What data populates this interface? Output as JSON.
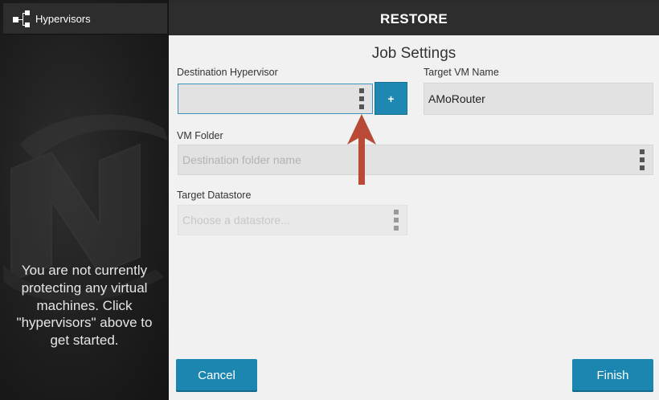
{
  "sidebar": {
    "header_label": "Hypervisors",
    "empty_message": "You are not currently protecting any virtual machines. Click \"hypervisors\" above to get started."
  },
  "topbar": {
    "title": "RESTORE"
  },
  "form": {
    "section_title": "Job Settings",
    "destination_hypervisor": {
      "label": "Destination Hypervisor",
      "value": "",
      "add_label": "+"
    },
    "target_vm_name": {
      "label": "Target VM Name",
      "value": "AMoRouter"
    },
    "vm_folder": {
      "label": "VM Folder",
      "placeholder": "Destination folder name"
    },
    "target_datastore": {
      "label": "Target Datastore",
      "placeholder": "Choose a datastore..."
    }
  },
  "buttons": {
    "cancel": "Cancel",
    "finish": "Finish"
  },
  "colors": {
    "accent": "#1b86b0",
    "annotation_arrow": "#b84a36",
    "header": "#2d2d2d"
  }
}
